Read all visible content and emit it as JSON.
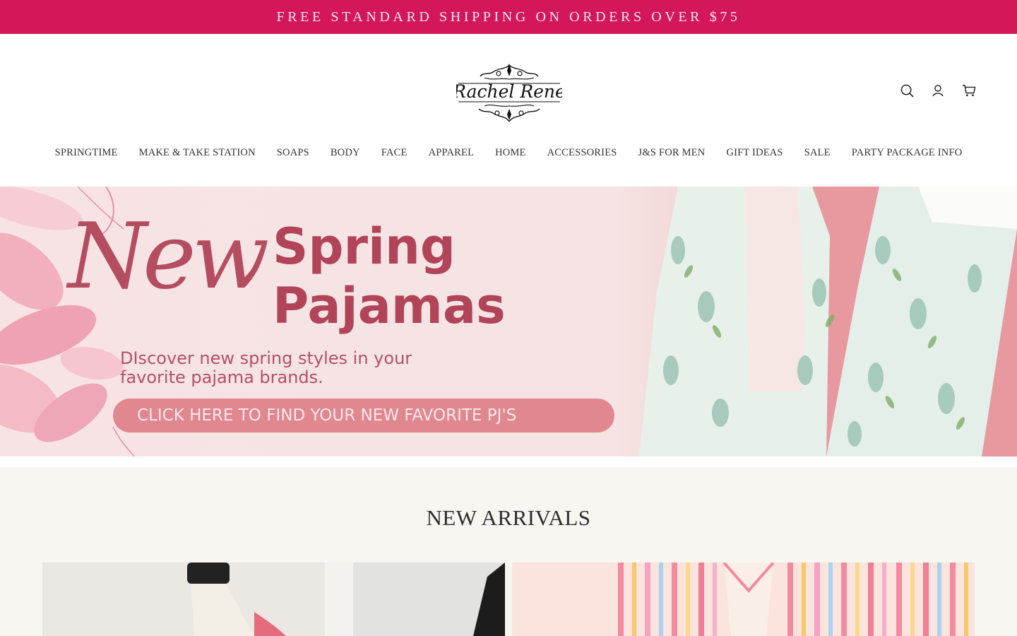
{
  "announcement": {
    "text": "FREE STANDARD SHIPPING ON ORDERS OVER $75"
  },
  "brand": {
    "logo_text": "Rachel Rene",
    "accent": "#d4175a"
  },
  "header_icons": [
    "search-icon",
    "account-icon",
    "cart-icon"
  ],
  "nav": {
    "items": [
      "SPRINGTIME",
      "MAKE & TAKE STATION",
      "SOAPS",
      "BODY",
      "FACE",
      "APPAREL",
      "HOME",
      "ACCESSORIES",
      "J&S FOR MEN",
      "GIFT IDEAS",
      "SALE",
      "PARTY PACKAGE INFO"
    ]
  },
  "hero": {
    "script_word": "New",
    "title_line1": "Spring",
    "title_line2": "Pajamas",
    "subtitle_line1": "DIscover new spring styles in your",
    "subtitle_line2": "favorite pajama brands.",
    "cta": "CLICK HERE TO FIND YOUR NEW FAVORITE PJ'S",
    "colors": {
      "background": "#f5dfe0",
      "title": "#b14458",
      "cta_bg": "#e0878f"
    }
  },
  "arrivals": {
    "title": "NEW ARRIVALS"
  }
}
